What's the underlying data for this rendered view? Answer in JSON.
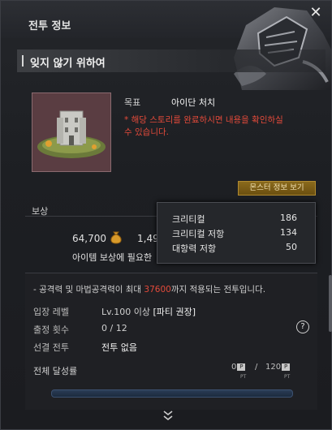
{
  "window": {
    "title": "전투 정보",
    "close_glyph": "✕"
  },
  "quest": {
    "title": "잊지 않기 위하여"
  },
  "goal": {
    "label": "목표",
    "value": "아이단 처치",
    "note": "* 해당 스토리를 완료하시면 내용을 확인하실 수 있습니다."
  },
  "monster_button": {
    "label": "몬스터 정보 보기"
  },
  "reward": {
    "label": "보상",
    "gold": "64,700",
    "second_value": "1,49",
    "note": "아이템 보상에 필요한"
  },
  "tooltip": {
    "rows": [
      {
        "label": "크리티컬",
        "value": "186"
      },
      {
        "label": "크리티컬 저항",
        "value": "134"
      },
      {
        "label": "대항력 저항",
        "value": "50"
      }
    ]
  },
  "info": {
    "line_prefix": "- 공격력 및 마법공격력이 최대 ",
    "line_value": "37600",
    "line_suffix": "까지 적용되는 전투입니다.",
    "rows": [
      {
        "label": "입장 레벨",
        "value": "Lv.100 이상",
        "extra": "[파티 권장]"
      },
      {
        "label": "출정 횟수",
        "value": "0 / 12",
        "extra": ""
      },
      {
        "label": "선결 전투",
        "value": "전투 없음",
        "extra": ""
      }
    ],
    "help_glyph": "?"
  },
  "progress": {
    "label": "전체 달성률",
    "current": "0",
    "separator": "/",
    "total": "120",
    "badge": "P",
    "unit": "PT",
    "fraction": 0
  },
  "icons": {
    "close": "close-icon",
    "help": "help-icon",
    "gold_bag": "gold-bag-icon",
    "collapse": "double-chevron-down-icon",
    "dungeon": "dungeon-thumbnail"
  },
  "colors": {
    "warning": "#e44a3a",
    "button": "#7a5c16",
    "tooltip_bg": "#25272b"
  }
}
